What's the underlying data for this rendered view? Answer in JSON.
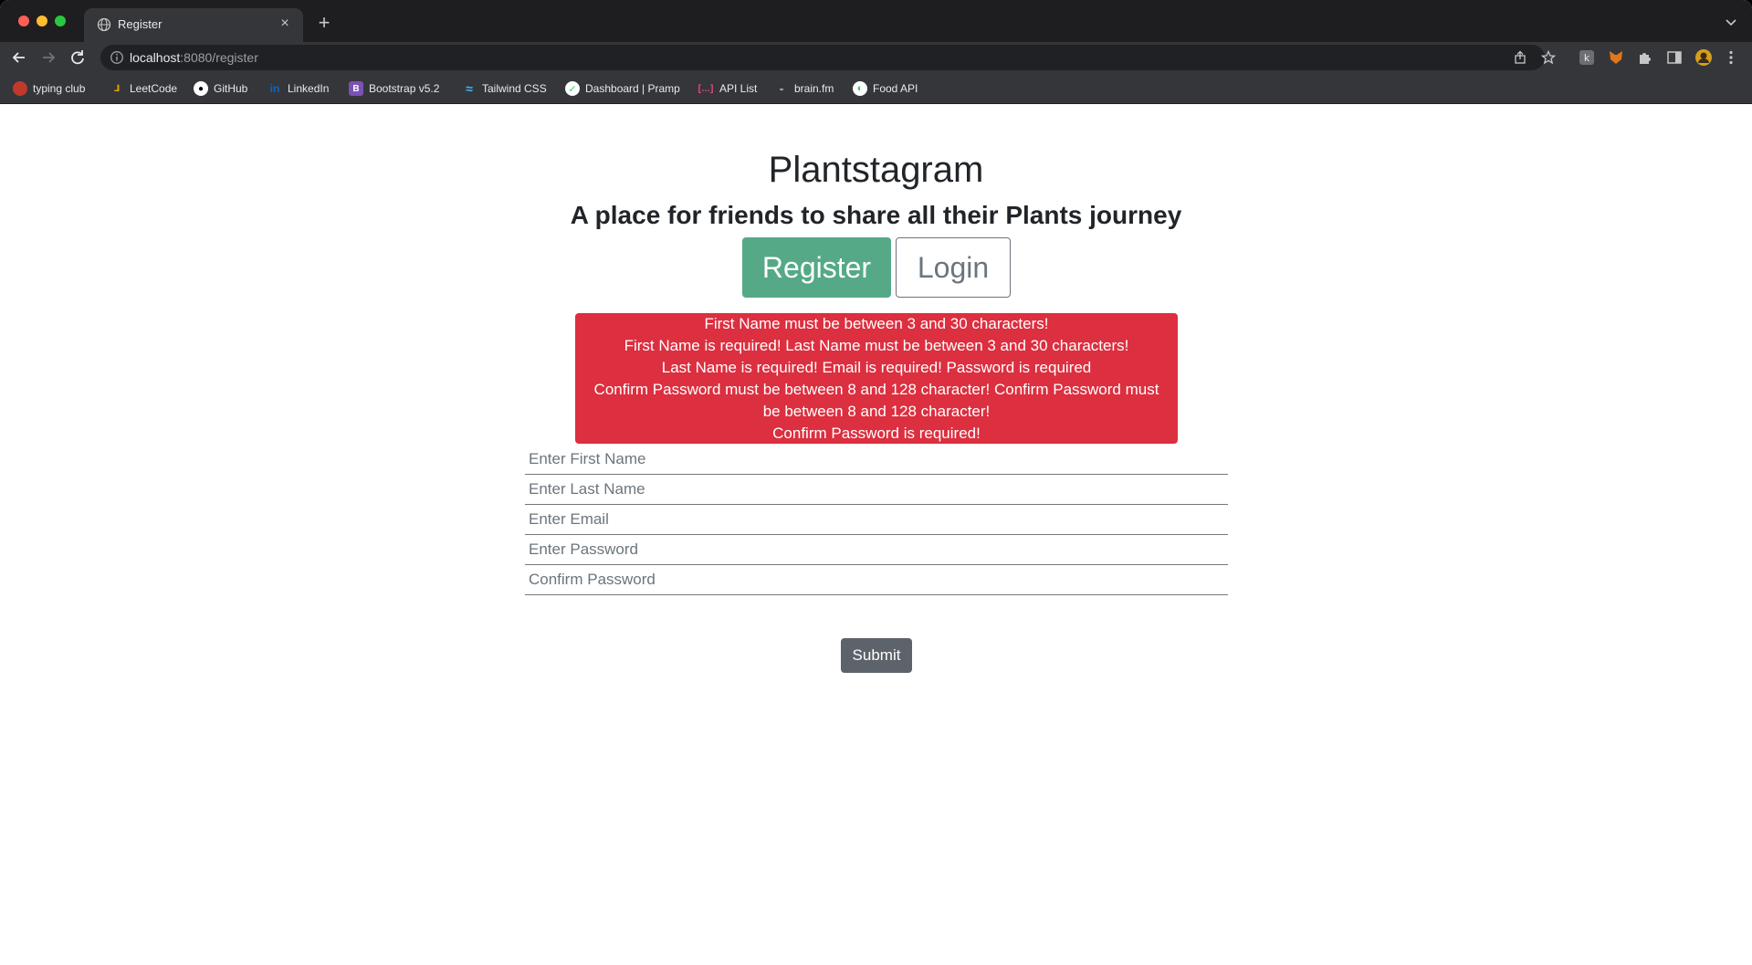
{
  "browser": {
    "tab_title": "Register",
    "url_host": "localhost",
    "url_rest": ":8080/register",
    "bookmarks": [
      {
        "label": "typing club",
        "icon": "typing-club-icon",
        "color": "#c0392b"
      },
      {
        "label": "LeetCode",
        "icon": "leetcode-icon",
        "color": "#f0a500"
      },
      {
        "label": "GitHub",
        "icon": "github-icon",
        "color": "#ffffff"
      },
      {
        "label": "LinkedIn",
        "icon": "linkedin-icon",
        "color": "#0a66c2"
      },
      {
        "label": "Bootstrap v5.2",
        "icon": "bootstrap-icon",
        "color": "#7952b3"
      },
      {
        "label": "Tailwind CSS",
        "icon": "tailwind-icon",
        "color": "#38bdf8"
      },
      {
        "label": "Dashboard | Pramp",
        "icon": "pramp-icon",
        "color": "#2ecc71"
      },
      {
        "label": "API List",
        "icon": "api-list-icon",
        "color": "#e74c8c"
      },
      {
        "label": "brain.fm",
        "icon": "brainfm-icon",
        "color": "#9aa0a6"
      },
      {
        "label": "Food API",
        "icon": "food-api-icon",
        "color": "#2ecc71"
      }
    ]
  },
  "header": {
    "title": "Plantstagram",
    "subtitle": "A place for friends to share all their Plants journey",
    "register_label": "Register",
    "login_label": "Login"
  },
  "errors": [
    "First Name must be between 3 and 30 characters!",
    "First Name is required! Last Name must be between 3 and 30 characters!",
    "Last Name is required! Email is required! Password is required",
    "Confirm Password must be between 8 and 128 character! Confirm Password must be between 8 and 128 character!",
    "Confirm Password is required!"
  ],
  "form": {
    "first_name_placeholder": "Enter First Name",
    "last_name_placeholder": "Enter Last Name",
    "email_placeholder": "Enter Email",
    "password_placeholder": "Enter Password",
    "confirm_password_placeholder": "Confirm Password",
    "submit_label": "Submit"
  },
  "colors": {
    "register_button": "#55a987",
    "alert_background": "#dc2f3f",
    "submit_button": "#5c636a"
  }
}
